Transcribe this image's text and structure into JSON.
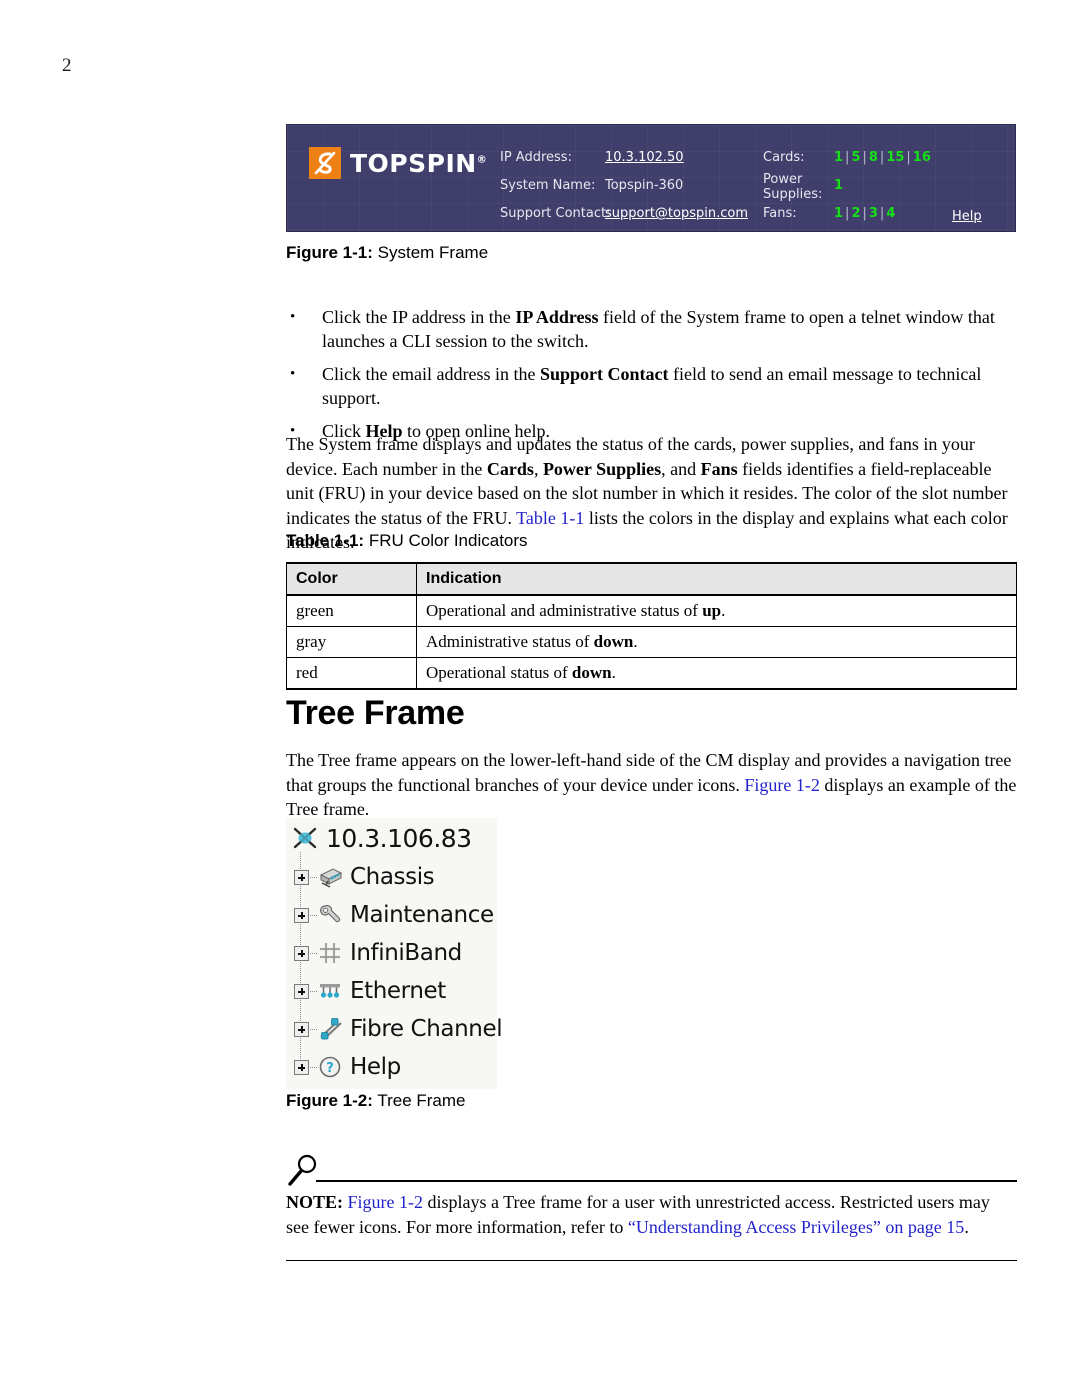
{
  "page": {
    "number": "2"
  },
  "system_frame": {
    "logo_text": "TOPSPIN",
    "logo_registered": "®",
    "labels": {
      "ip_address": "IP Address:",
      "system_name": "System Name:",
      "support_contact": "Support Contact:",
      "cards": "Cards:",
      "power_supplies_line1": "Power",
      "power_supplies_line2": "Supplies:",
      "fans": "Fans:"
    },
    "values": {
      "ip_address": "10.3.102.50",
      "system_name": "Topspin-360",
      "support_contact": "support@topspin.com"
    },
    "cards": [
      "1",
      "5",
      "8",
      "15",
      "16"
    ],
    "power_supplies": [
      "1"
    ],
    "fans": [
      "1",
      "2",
      "3",
      "4"
    ],
    "separator": "|",
    "help_link": "Help",
    "colors": {
      "background": "#403f6c",
      "status_green": "#16e016",
      "logo_orange": "#ee8016",
      "label_text": "#e7e7ef"
    }
  },
  "figure_1_1": {
    "label": "Figure 1-1:",
    "title": "System Frame"
  },
  "bullets": [
    {
      "pre": "Click the IP address in the ",
      "bold": "IP Address",
      "post": " field of the System frame to open a telnet window that launches a CLI session to the switch."
    },
    {
      "pre": "Click the email address in the ",
      "bold": "Support Contact",
      "post": " field to send an email message to technical support."
    },
    {
      "pre": "Click ",
      "bold": "Help",
      "post": " to open online help."
    }
  ],
  "paragraph_system_frame": {
    "s1": "The System frame displays and updates the status of the cards, power supplies, and fans in your device. Each number in the ",
    "b1": "Cards",
    "s2": ", ",
    "b2": "Power Supplies",
    "s3": ", and ",
    "b3": "Fans",
    "s4": " fields identifies a field-replaceable unit (FRU) in your device based on the slot number in which it resides. The color of the slot number indicates the status of the FRU. ",
    "link": "Table 1-1",
    "s5": " lists the colors in the display and explains what each color indicates."
  },
  "table_1_1": {
    "label": "Table 1-1:",
    "title": "FRU Color Indicators",
    "columns": [
      "Color",
      "Indication"
    ],
    "rows": [
      {
        "color": "green",
        "pre": "Operational and administrative status of ",
        "bold": "up",
        "post": "."
      },
      {
        "color": "gray",
        "pre": "Administrative status of ",
        "bold": "down",
        "post": "."
      },
      {
        "color": "red",
        "pre": "Operational status of ",
        "bold": "down",
        "post": "."
      }
    ]
  },
  "section": {
    "heading": "Tree Frame",
    "paragraph": {
      "s1": "The Tree frame appears on the lower-left-hand side of the CM display and provides a navigation tree that groups the functional branches of your device under icons. ",
      "link": "Figure 1-2",
      "s2": " displays an example of the Tree frame."
    }
  },
  "tree_frame": {
    "root": {
      "label": "10.3.106.83",
      "icon": "switch-node-icon"
    },
    "nodes": [
      {
        "label": "Chassis",
        "icon": "chassis-icon",
        "expander": "plus"
      },
      {
        "label": "Maintenance",
        "icon": "wrench-icon",
        "expander": "plus"
      },
      {
        "label": "InfiniBand",
        "icon": "infiniband-icon",
        "expander": "plus"
      },
      {
        "label": "Ethernet",
        "icon": "ethernet-icon",
        "expander": "plus"
      },
      {
        "label": "Fibre Channel",
        "icon": "fibre-channel-icon",
        "expander": "plus"
      },
      {
        "label": "Help",
        "icon": "help-question-icon",
        "expander": "plus"
      }
    ],
    "background": "#f7f7f4"
  },
  "figure_1_2": {
    "label": "Figure 1-2:",
    "title": "Tree Frame"
  },
  "note": {
    "icon": "magnifier-icon",
    "label": "NOTE:",
    "link1": "Figure 1-2",
    "s1": " displays a Tree frame for a user with unrestricted access. Restricted users may see fewer icons. For more information, refer to ",
    "link2": "“Understanding Access Privileges” on page 15",
    "s2": "."
  }
}
